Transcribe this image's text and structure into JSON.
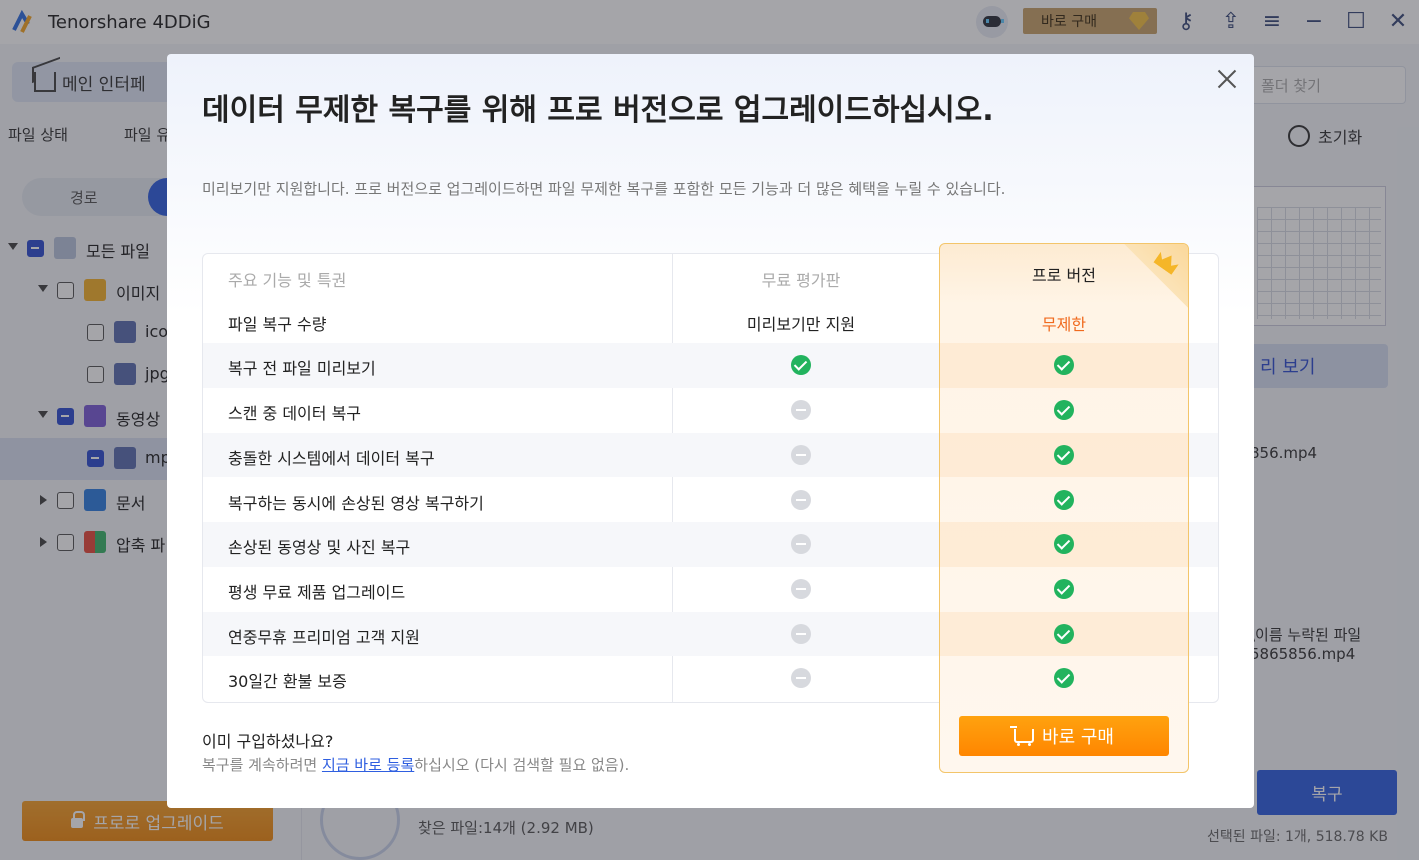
{
  "app": {
    "title": "Tenorshare 4DDiG",
    "buy_label": "바로 구매",
    "home_tab": "메인 인터페",
    "folder_search_placeholder": "폴더 찾기",
    "filters": [
      "파일 상태",
      "파일 유"
    ],
    "reset_label": "초기화",
    "view_toggle_label": "경로",
    "tree": [
      {
        "label": "모든 파일"
      },
      {
        "label": "이미지"
      },
      {
        "label": "ico"
      },
      {
        "label": "jpg"
      },
      {
        "label": "동영상"
      },
      {
        "label": "mp"
      },
      {
        "label": "문서"
      },
      {
        "label": "압축 파"
      }
    ],
    "upgrade_label": "프로로 업그레이드",
    "preview_label": "리 보기",
    "right_file_1": "856.mp4",
    "right_path_1": "\\이름 누락된 파일",
    "right_path_2": "5865856.mp4",
    "recover_label": "복구",
    "found_files": "찾은 파일:14개 (2.92 MB)",
    "selected_info": "선택된 파일: 1개, 518.78 KB"
  },
  "modal": {
    "title": "데이터 무제한 복구를 위해 프로 버전으로 업그레이드하십시오.",
    "subtitle": "미리보기만 지원합니다. 프로 버전으로 업그레이드하면 파일 무제한 복구를 포함한 모든 기능과 더 많은 혜택을 누릴 수 있습니다.",
    "table": {
      "header_feature": "주요 기능 및 특권",
      "header_free": "무료 평가판",
      "header_pro": "프로 버전",
      "rows": [
        {
          "feature": "파일 복구 수량",
          "free": "미리보기만 지원",
          "pro": "무제한"
        },
        {
          "feature": "복구 전 파일 미리보기",
          "free": "check",
          "pro": "check"
        },
        {
          "feature": "스캔 중 데이터 복구",
          "free": "minus",
          "pro": "check"
        },
        {
          "feature": "충돌한 시스템에서 데이터 복구",
          "free": "minus",
          "pro": "check"
        },
        {
          "feature": "복구하는 동시에 손상된 영상 복구하기",
          "free": "minus",
          "pro": "check"
        },
        {
          "feature": "손상된 동영상 및 사진 복구",
          "free": "minus",
          "pro": "check"
        },
        {
          "feature": "평생 무료 제품 업그레이드",
          "free": "minus",
          "pro": "check"
        },
        {
          "feature": "연중무휴 프리미엄 고객 지원",
          "free": "minus",
          "pro": "check"
        },
        {
          "feature": "30일간 환불 보증",
          "free": "minus",
          "pro": "check"
        }
      ]
    },
    "buy_now": "바로 구매",
    "already_purchased": "이미 구입하셨나요?",
    "register_prefix": "복구를 계속하려면 ",
    "register_link": "지금 바로 등록",
    "register_suffix": "하십시오 (다시 검색할 필요 없음).",
    "colors": {
      "accent": "#ff8c00",
      "check": "#22b35e",
      "link": "#2f5fe0",
      "unlimited": "#f06a1e"
    }
  }
}
